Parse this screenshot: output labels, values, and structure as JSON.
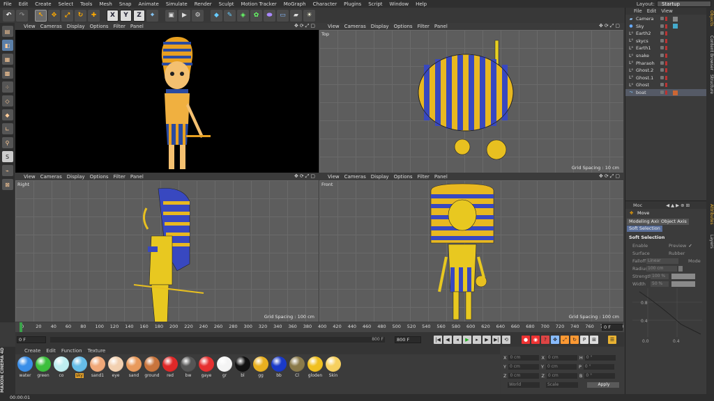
{
  "menu": [
    "File",
    "Edit",
    "Create",
    "Select",
    "Tools",
    "Mesh",
    "Snap",
    "Animate",
    "Simulate",
    "Render",
    "Sculpt",
    "Motion Tracker",
    "MoGraph",
    "Character",
    "Plugins",
    "Script",
    "Window",
    "Help"
  ],
  "layout": {
    "label": "Layout:",
    "value": "Startup"
  },
  "viewport_menu": [
    "View",
    "Cameras",
    "Display",
    "Options",
    "Filter",
    "Panel"
  ],
  "viewports": [
    {
      "name": "",
      "grid": ""
    },
    {
      "name": "Top",
      "grid": "Grid Spacing : 10 cm"
    },
    {
      "name": "Right",
      "grid": "Grid Spacing : 100 cm"
    },
    {
      "name": "Front",
      "grid": "Grid Spacing : 100 cm"
    }
  ],
  "timeline": {
    "ticks": [
      "0",
      "20",
      "40",
      "60",
      "80",
      "100",
      "120",
      "140",
      "160",
      "180",
      "200",
      "220",
      "240",
      "260",
      "280",
      "300",
      "320",
      "340",
      "360",
      "380",
      "400",
      "420",
      "440",
      "460",
      "480",
      "500",
      "520",
      "540",
      "560",
      "580",
      "600",
      "620",
      "640",
      "660",
      "680",
      "700",
      "720",
      "740",
      "760",
      "780",
      "800"
    ],
    "start_field": "0 F",
    "end_field": "800 F",
    "range_end": "800 F",
    "frame_field": "0 F"
  },
  "material_menu": [
    "Create",
    "Edit",
    "Function",
    "Texture"
  ],
  "materials": [
    {
      "name": "water",
      "color": "#3a8ee8"
    },
    {
      "name": "green",
      "color": "#3cbf3c"
    },
    {
      "name": "co",
      "color": "#bfeef0"
    },
    {
      "name": "sky",
      "color": "#66bde8",
      "selected": true
    },
    {
      "name": "sand1",
      "color": "#f0a878"
    },
    {
      "name": "eye",
      "color": "#f2d0b0"
    },
    {
      "name": "sand",
      "color": "#e89a5c"
    },
    {
      "name": "ground",
      "color": "#c8743c"
    },
    {
      "name": "red",
      "color": "#e02828"
    },
    {
      "name": "bw",
      "color": "#555555"
    },
    {
      "name": "gaye",
      "color": "#e63030"
    },
    {
      "name": "gr",
      "color": "#f4f4f4"
    },
    {
      "name": "bl",
      "color": "#111111"
    },
    {
      "name": "gg",
      "color": "#e8b020"
    },
    {
      "name": "bb",
      "color": "#1a3ac8"
    },
    {
      "name": "Cl",
      "color": "#8a7a4a"
    },
    {
      "name": "gloden",
      "color": "#f0c020"
    },
    {
      "name": "Skin",
      "color": "#f6d060"
    }
  ],
  "coords": {
    "rows": [
      {
        "a": "X",
        "av": "0 cm",
        "b": "X",
        "bv": "0 cm",
        "c": "H",
        "cv": "0 °"
      },
      {
        "a": "Y",
        "av": "0 cm",
        "b": "Y",
        "bv": "0 cm",
        "c": "P",
        "cv": "0 °"
      },
      {
        "a": "Z",
        "av": "0 cm",
        "b": "Z",
        "bv": "0 cm",
        "c": "B",
        "cv": "0 °"
      }
    ],
    "world": "World",
    "scale": "Scale",
    "apply": "Apply"
  },
  "object_menu": [
    "File",
    "Edit",
    "View"
  ],
  "objects": [
    {
      "name": "Camera",
      "icon": "camera-icon"
    },
    {
      "name": "Sky",
      "icon": "sky-icon"
    },
    {
      "name": "Earth2",
      "icon": "null-object-icon"
    },
    {
      "name": "skycs",
      "icon": "null-object-icon"
    },
    {
      "name": "Earth1",
      "icon": "null-object-icon"
    },
    {
      "name": "snake",
      "icon": "null-object-icon"
    },
    {
      "name": "Pharaoh",
      "icon": "null-object-icon"
    },
    {
      "name": "Ghost.2",
      "icon": "null-object-icon"
    },
    {
      "name": "Ghost.1",
      "icon": "null-object-icon"
    },
    {
      "name": "Ghost",
      "icon": "null-object-icon"
    },
    {
      "name": "boat",
      "icon": "boat-icon"
    }
  ],
  "side_tabs": [
    "Objects",
    "Content Browser",
    "Structure",
    "Attributes",
    "Layers"
  ],
  "attributes": {
    "mode": "Moc",
    "tool": "Move",
    "tabs": [
      "Modeling Axis",
      "Object Axis",
      "Soft Selection"
    ],
    "section": "Soft Selection",
    "params": [
      {
        "label": "Enable",
        "value": ""
      },
      {
        "label": "Surface",
        "value": ""
      },
      {
        "label": "Falloff",
        "value": "Linear"
      },
      {
        "label": "Radius",
        "value": "100 cm"
      },
      {
        "label": "Strength",
        "value": "100 %"
      },
      {
        "label": "Width",
        "value": "50 %"
      }
    ],
    "right_params": [
      "Preview",
      "Rubber",
      "Mode"
    ],
    "graph_labels": [
      "0.8",
      "0.4",
      "0.0",
      "0.4"
    ]
  },
  "status": "00:00:01",
  "brand": "MAXON CINEMA 4D"
}
